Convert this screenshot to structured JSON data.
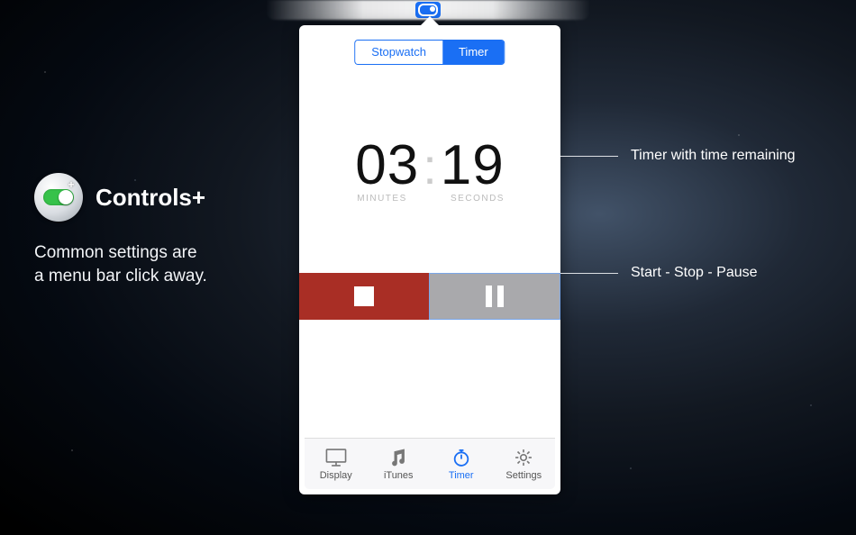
{
  "menubar_icon": "controls-plus-toggle-icon",
  "segmented": {
    "stopwatch": "Stopwatch",
    "timer": "Timer",
    "active": "timer"
  },
  "time": {
    "minutes": "03",
    "seconds": "19",
    "minutes_label": "MINUTES",
    "seconds_label": "SECONDS"
  },
  "controls": {
    "stop_icon": "stop-icon",
    "pause_icon": "pause-icon"
  },
  "tabs": {
    "display": "Display",
    "itunes": "iTunes",
    "timer": "Timer",
    "settings": "Settings",
    "active": "timer"
  },
  "promo": {
    "title": "Controls+",
    "sub_line1": "Common settings are",
    "sub_line2": "a menu bar click away."
  },
  "callouts": {
    "timer_remaining": "Timer with time remaining",
    "start_stop_pause": "Start - Stop - Pause"
  },
  "colors": {
    "accent": "#1a6ff4",
    "stop_red": "#a92e25",
    "pause_gray": "#a9a9ac"
  }
}
